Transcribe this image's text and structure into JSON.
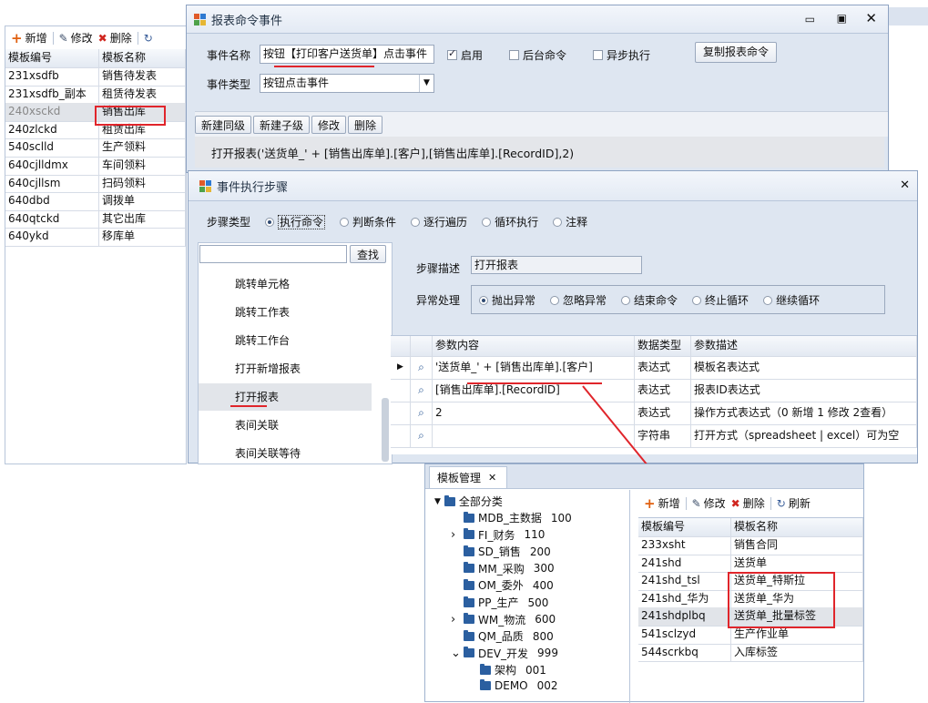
{
  "bg_left": {
    "toolbar": {
      "add": "新增",
      "edit": "修改",
      "delete": "删除"
    },
    "headers": [
      "模板编号",
      "模板名称"
    ],
    "rows": [
      [
        "231xsdfb",
        "销售待发表"
      ],
      [
        "231xsdfb_副本",
        "租赁待发表"
      ],
      [
        "240xsckd",
        "销售出库"
      ],
      [
        "240zlckd",
        "租赁出库"
      ],
      [
        "540sclld",
        "生产领料"
      ],
      [
        "640cjlldmx",
        "车间领料"
      ],
      [
        "640cjllsm",
        "扫码领料"
      ],
      [
        "640dbd",
        "调拨单"
      ],
      [
        "640qtckd",
        "其它出库"
      ],
      [
        "640ykd",
        "移库单"
      ]
    ]
  },
  "cmd_window": {
    "title": "报表命令事件",
    "event_name_label": "事件名称",
    "event_name_value": "按钮【打印客户送货单】点击事件",
    "enable_label": "启用",
    "background_label": "后台命令",
    "async_label": "异步执行",
    "copy_button": "复制报表命令",
    "event_type_label": "事件类型",
    "event_type_value": "按钮点击事件",
    "actions": [
      "新建同级",
      "新建子级",
      "修改",
      "删除"
    ],
    "command_text": "打开报表('送货单_' + [销售出库单].[客户],[销售出库单].[RecordID],2)"
  },
  "step_window": {
    "title": "事件执行步骤",
    "step_type_label": "步骤类型",
    "step_types": [
      "执行命令",
      "判断条件",
      "逐行遍历",
      "循环执行",
      "注释"
    ],
    "search_button": "查找",
    "list_items": [
      "跳转单元格",
      "跳转工作表",
      "跳转工作台",
      "打开新增报表",
      "打开报表",
      "表间关联",
      "表间关联等待"
    ],
    "desc_label": "步骤描述",
    "desc_value": "打开报表",
    "exception_label": "异常处理",
    "exception_options": [
      "抛出异常",
      "忽略异常",
      "结束命令",
      "终止循环",
      "继续循环"
    ],
    "param_headers": [
      "参数内容",
      "数据类型",
      "参数描述"
    ],
    "params": [
      [
        "'送货单_' + [销售出库单].[客户]",
        "表达式",
        "模板名表达式"
      ],
      [
        "[销售出库单].[RecordID]",
        "表达式",
        "报表ID表达式"
      ],
      [
        "2",
        "表达式",
        "操作方式表达式（0 新增 1 修改 2查看）"
      ],
      [
        "",
        "字符串",
        "打开方式（spreadsheet | excel）可为空"
      ]
    ]
  },
  "template_window": {
    "tab_label": "模板管理",
    "tree_root": "全部分类",
    "tree": [
      {
        "name": "MDB_主数据",
        "num": "100"
      },
      {
        "name": "FI_财务",
        "num": "110"
      },
      {
        "name": "SD_销售",
        "num": "200"
      },
      {
        "name": "MM_采购",
        "num": "300"
      },
      {
        "name": "OM_委外",
        "num": "400"
      },
      {
        "name": "PP_生产",
        "num": "500"
      },
      {
        "name": "WM_物流",
        "num": "600"
      },
      {
        "name": "QM_品质",
        "num": "800"
      },
      {
        "name": "DEV_开发",
        "num": "999"
      }
    ],
    "tree_children": [
      {
        "name": "架构",
        "num": "001"
      },
      {
        "name": "DEMO",
        "num": "002"
      }
    ],
    "toolbar": {
      "add": "新增",
      "edit": "修改",
      "delete": "删除",
      "refresh": "刷新"
    },
    "headers": [
      "模板编号",
      "模板名称"
    ],
    "rows": [
      [
        "233xsht",
        "销售合同"
      ],
      [
        "241shd",
        "送货单"
      ],
      [
        "241shd_tsl",
        "送货单_特斯拉"
      ],
      [
        "241shd_华为",
        "送货单_华为"
      ],
      [
        "241shdplbq",
        "送货单_批量标签"
      ],
      [
        "541sclzyd",
        "生产作业单"
      ],
      [
        "544scrkbq",
        "入库标签"
      ]
    ]
  },
  "colors": {
    "annotation_red": "#e0252b",
    "folder_blue": "#2b5fa0"
  }
}
